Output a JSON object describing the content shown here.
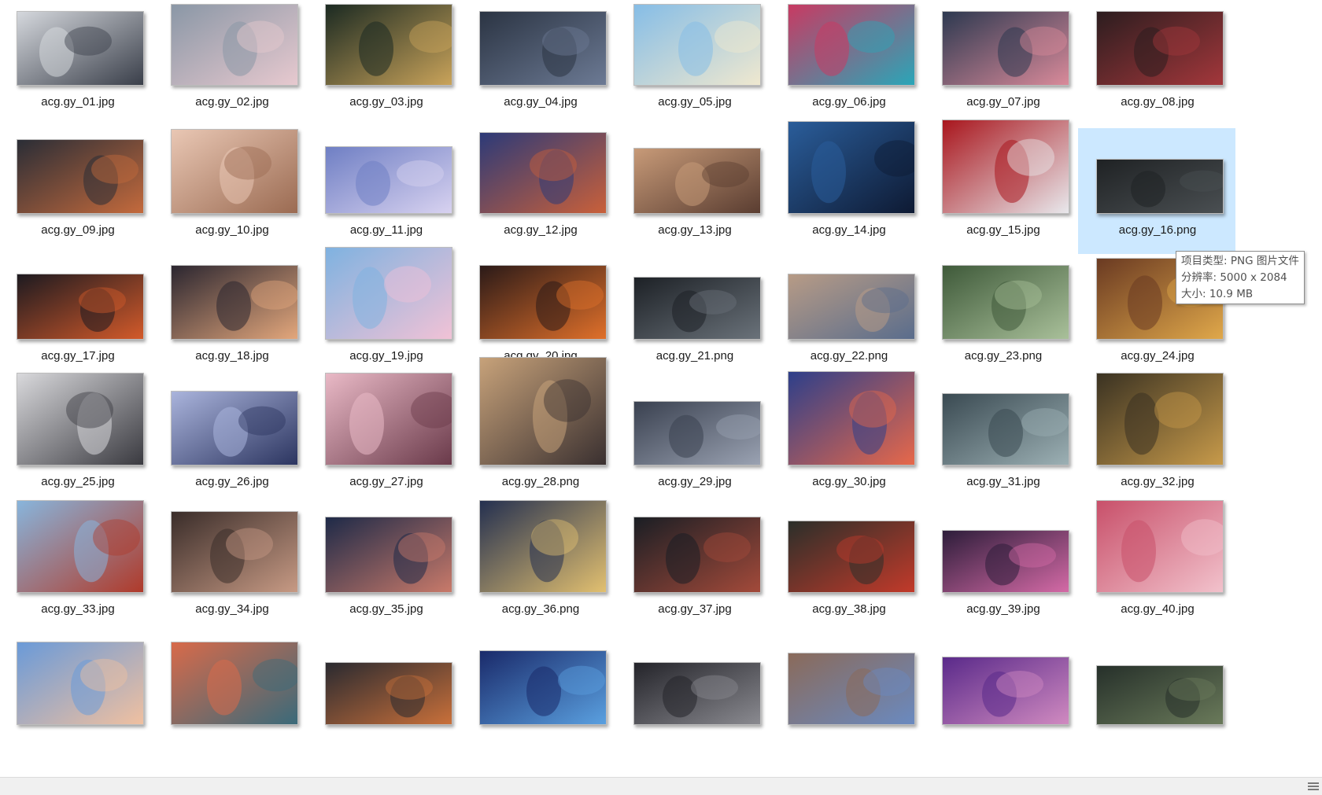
{
  "files": [
    {
      "name": "acg.gy_01.jpg",
      "colors": [
        "#d5d8dd",
        "#3a3f4a"
      ]
    },
    {
      "name": "acg.gy_02.jpg",
      "colors": [
        "#8a97a6",
        "#e7c9cf"
      ]
    },
    {
      "name": "acg.gy_03.jpg",
      "colors": [
        "#1b2a22",
        "#c9a35a"
      ]
    },
    {
      "name": "acg.gy_04.jpg",
      "colors": [
        "#2b3443",
        "#6c7a94"
      ]
    },
    {
      "name": "acg.gy_05.jpg",
      "colors": [
        "#86bde6",
        "#efe8cf"
      ]
    },
    {
      "name": "acg.gy_06.jpg",
      "colors": [
        "#c83a62",
        "#2aa6b8"
      ]
    },
    {
      "name": "acg.gy_07.jpg",
      "colors": [
        "#2d3950",
        "#d98a9a"
      ]
    },
    {
      "name": "acg.gy_08.jpg",
      "colors": [
        "#2c1d1f",
        "#a3373b"
      ]
    },
    {
      "name": "acg.gy_09.jpg",
      "colors": [
        "#2a2d36",
        "#c46a3c"
      ]
    },
    {
      "name": "acg.gy_10.jpg",
      "colors": [
        "#e9c7b4",
        "#9b6b52"
      ]
    },
    {
      "name": "acg.gy_11.jpg",
      "colors": [
        "#6f7fc4",
        "#d8d2f0"
      ]
    },
    {
      "name": "acg.gy_12.jpg",
      "colors": [
        "#2c3a78",
        "#c9603a"
      ]
    },
    {
      "name": "acg.gy_13.jpg",
      "colors": [
        "#c79a78",
        "#5a3d31"
      ]
    },
    {
      "name": "acg.gy_14.jpg",
      "colors": [
        "#2a5d9a",
        "#0e1a33"
      ]
    },
    {
      "name": "acg.gy_15.jpg",
      "colors": [
        "#a9161d",
        "#e8e8ec"
      ]
    },
    {
      "name": "acg.gy_16.png",
      "colors": [
        "#1f2224",
        "#4a4f52"
      ]
    },
    {
      "name": "acg.gy_17.jpg",
      "colors": [
        "#1d1a20",
        "#d35a2a"
      ]
    },
    {
      "name": "acg.gy_18.jpg",
      "colors": [
        "#2b2630",
        "#e3a77c"
      ]
    },
    {
      "name": "acg.gy_19.jpg",
      "colors": [
        "#7fb2e0",
        "#f1c2d6"
      ]
    },
    {
      "name": "acg.gy_20.jpg",
      "colors": [
        "#2b1a18",
        "#e0702a"
      ]
    },
    {
      "name": "acg.gy_21.png",
      "colors": [
        "#1d2126",
        "#6a727a"
      ]
    },
    {
      "name": "acg.gy_22.png",
      "colors": [
        "#b79b86",
        "#5a6d8c"
      ]
    },
    {
      "name": "acg.gy_23.png",
      "colors": [
        "#3f5a3a",
        "#a9c09a"
      ]
    },
    {
      "name": "acg.gy_24.jpg",
      "colors": [
        "#6a3a22",
        "#e0a84a"
      ]
    },
    {
      "name": "acg.gy_25.jpg",
      "colors": [
        "#d9d9dc",
        "#3a3a40"
      ]
    },
    {
      "name": "acg.gy_26.jpg",
      "colors": [
        "#aab4dc",
        "#2c3560"
      ]
    },
    {
      "name": "acg.gy_27.jpg",
      "colors": [
        "#e9b9c6",
        "#6a3a4a"
      ]
    },
    {
      "name": "acg.gy_28.png",
      "colors": [
        "#c7a27a",
        "#3a3030"
      ]
    },
    {
      "name": "acg.gy_29.jpg",
      "colors": [
        "#3a4150",
        "#9aa2b2"
      ]
    },
    {
      "name": "acg.gy_30.jpg",
      "colors": [
        "#2d3f8a",
        "#e7684a"
      ]
    },
    {
      "name": "acg.gy_31.jpg",
      "colors": [
        "#3a4a52",
        "#9cb0b4"
      ]
    },
    {
      "name": "acg.gy_32.jpg",
      "colors": [
        "#3a3222",
        "#c79a4a"
      ]
    },
    {
      "name": "acg.gy_33.jpg",
      "colors": [
        "#88b5dc",
        "#b03a2a"
      ]
    },
    {
      "name": "acg.gy_34.jpg",
      "colors": [
        "#3a2d2a",
        "#c79a84"
      ]
    },
    {
      "name": "acg.gy_35.jpg",
      "colors": [
        "#1e2a48",
        "#c97a6a"
      ]
    },
    {
      "name": "acg.gy_36.png",
      "colors": [
        "#243050",
        "#e2c070"
      ]
    },
    {
      "name": "acg.gy_37.jpg",
      "colors": [
        "#1a1e24",
        "#a34a3a"
      ]
    },
    {
      "name": "acg.gy_38.jpg",
      "colors": [
        "#2b2f2a",
        "#c23a2a"
      ]
    },
    {
      "name": "acg.gy_39.jpg",
      "colors": [
        "#2d1d3a",
        "#d46aa6"
      ]
    },
    {
      "name": "acg.gy_40.jpg",
      "colors": [
        "#c8506a",
        "#f2c2cc"
      ]
    },
    {
      "name": "",
      "colors": [
        "#6a9ad8",
        "#f0c0a0"
      ]
    },
    {
      "name": "",
      "colors": [
        "#d86a4a",
        "#3a6a7a"
      ]
    },
    {
      "name": "",
      "colors": [
        "#2a2a30",
        "#c9703a"
      ]
    },
    {
      "name": "",
      "colors": [
        "#1a2a6a",
        "#5aa0e0"
      ]
    },
    {
      "name": "",
      "colors": [
        "#24242a",
        "#8a8a90"
      ]
    },
    {
      "name": "",
      "colors": [
        "#8a6a5a",
        "#6a8ac0"
      ]
    },
    {
      "name": "",
      "colors": [
        "#5a2a8a",
        "#d08ac0"
      ]
    },
    {
      "name": "",
      "colors": [
        "#26302a",
        "#6a7a5a"
      ]
    }
  ],
  "tooltip": {
    "line1": "项目类型: PNG 图片文件",
    "line2": "分辨率: 5000 x 2084",
    "line3": "大小: 10.9 MB"
  },
  "selected_item": "acg.gy_16.png",
  "accent": "#cce8ff"
}
